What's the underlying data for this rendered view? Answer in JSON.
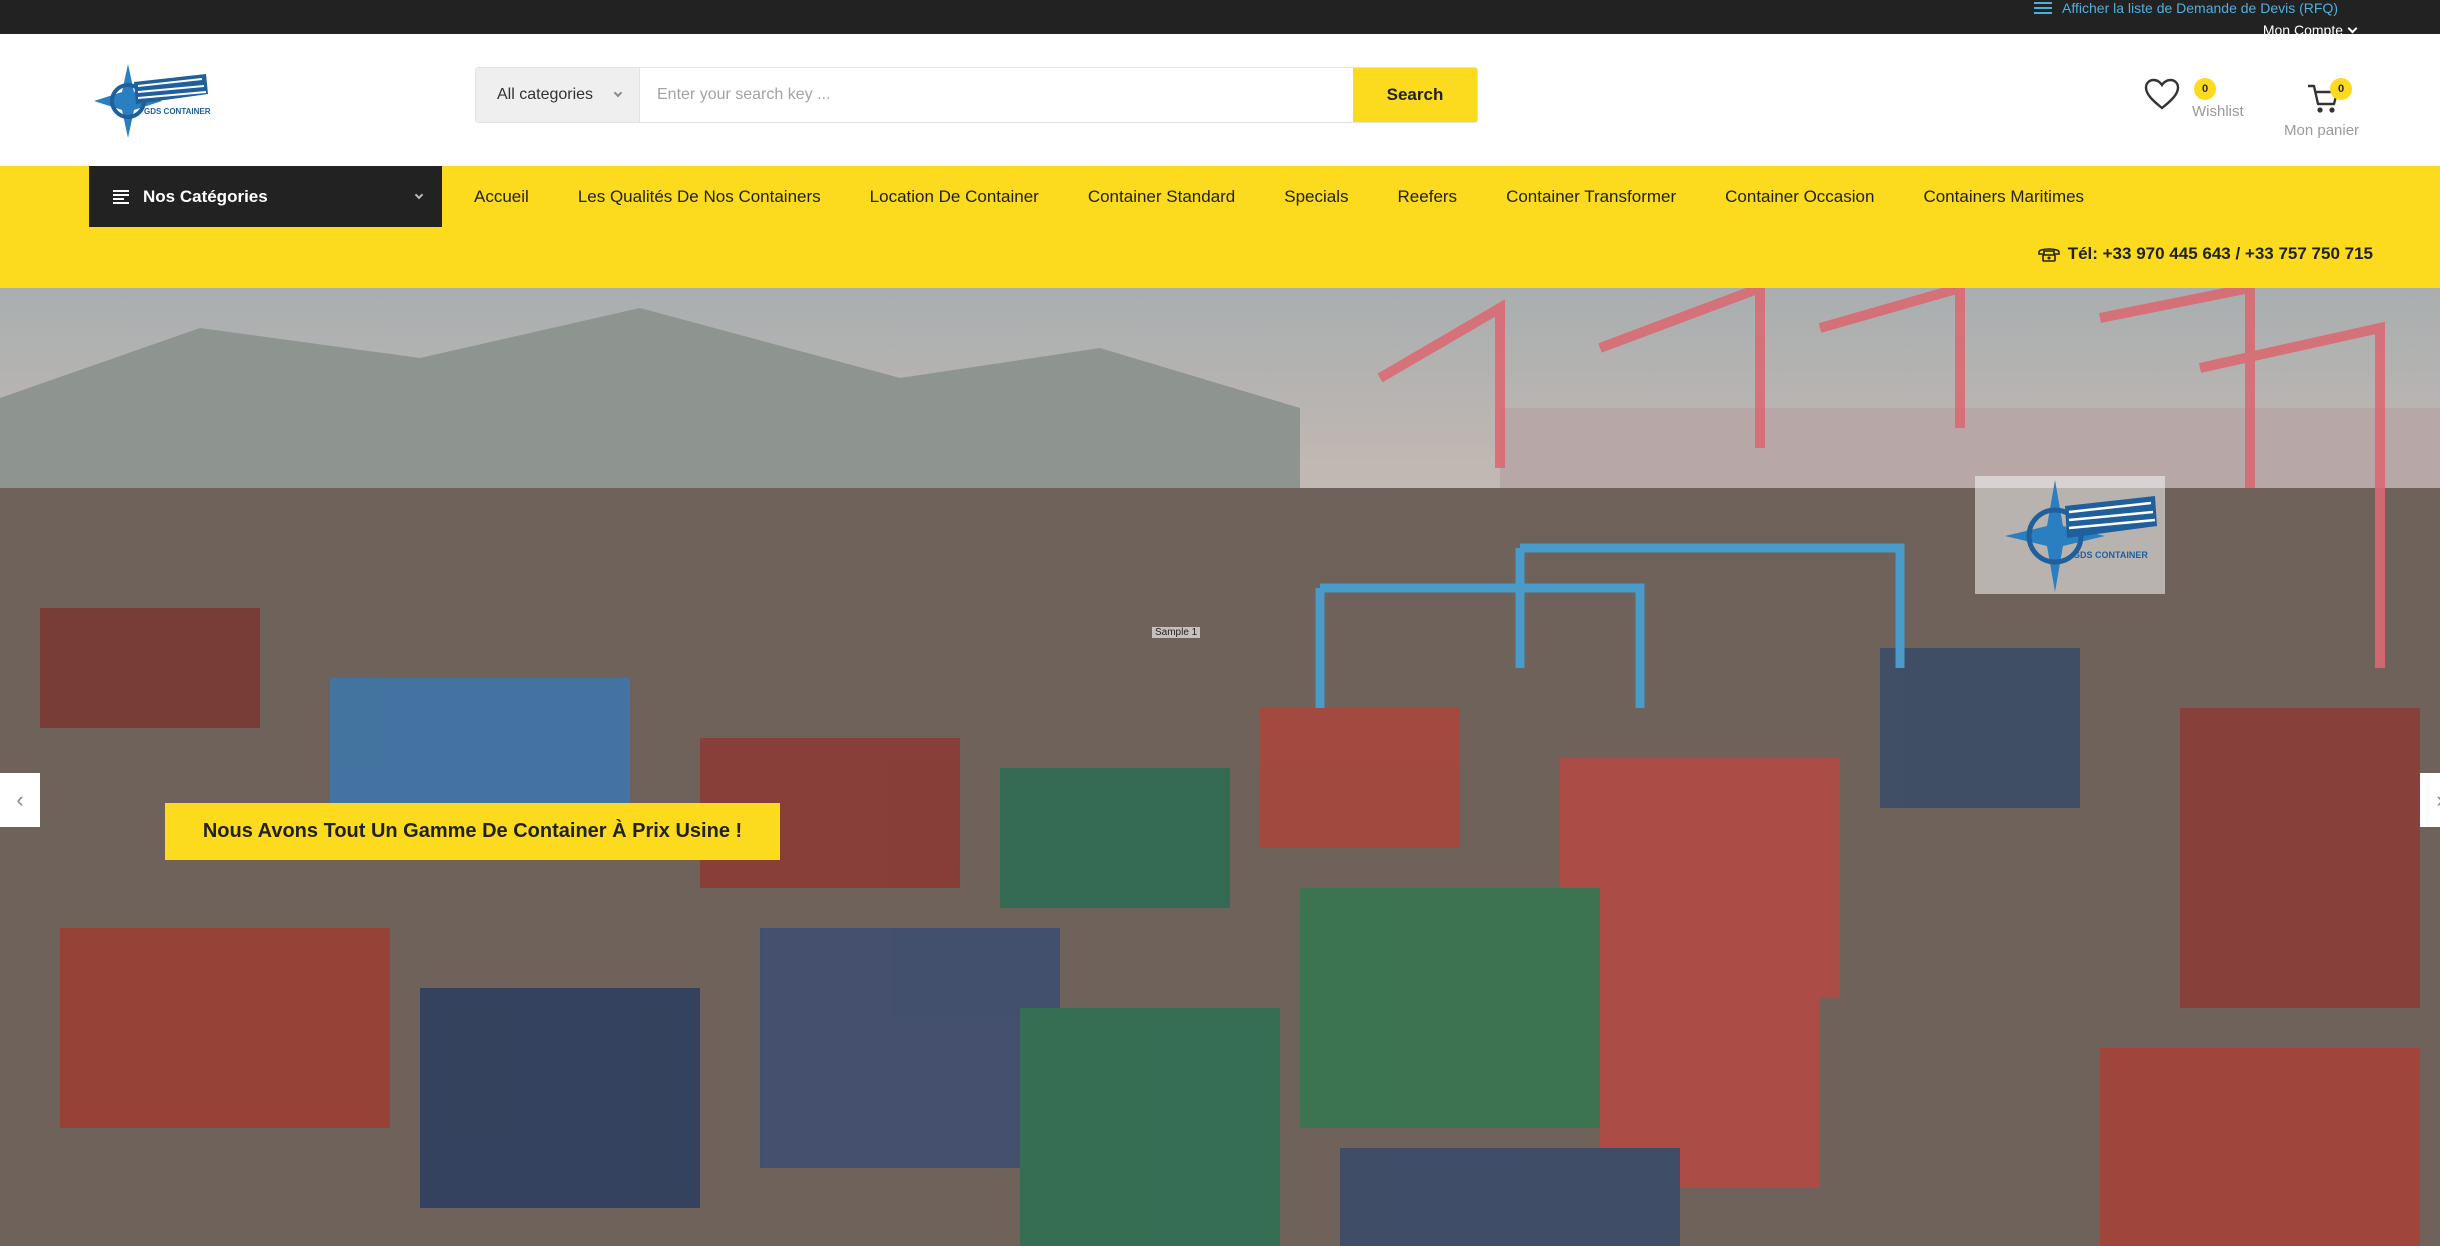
{
  "topbar": {
    "rfq_label": "Afficher la liste de Demande de Devis (RFQ)",
    "account_label": "Mon Compte"
  },
  "header": {
    "logo_text": "GDS CONTAINER",
    "search": {
      "category_selected": "All categories",
      "placeholder": "Enter your search key ...",
      "button_label": "Search"
    },
    "wishlist": {
      "count": "0",
      "label": "Wishlist"
    },
    "cart": {
      "count": "0",
      "label": "Mon panier"
    }
  },
  "nav": {
    "categories_label": "Nos Catégories",
    "items": [
      {
        "label": "Accueil"
      },
      {
        "label": "Les Qualités De Nos Containers"
      },
      {
        "label": "Location De Container"
      },
      {
        "label": "Container Standard"
      },
      {
        "label": "Specials"
      },
      {
        "label": "Reefers"
      },
      {
        "label": "Container Transformer"
      },
      {
        "label": "Container Occasion"
      },
      {
        "label": "Containers Maritimes"
      }
    ],
    "phone": "Tél: +33 970 445 643 / +33 757 750 715"
  },
  "hero": {
    "banner_text": "Nous Avons Tout Un Gamme De Container À Prix Usine !",
    "sample_label": "Sample 1",
    "logo_text": "GDS CONTAINER",
    "prev_icon": "chevron-left-icon",
    "next_icon": "chevron-right-icon"
  },
  "colors": {
    "accent": "#fcda1e",
    "topbar": "#222222",
    "link": "#4fb0de"
  }
}
